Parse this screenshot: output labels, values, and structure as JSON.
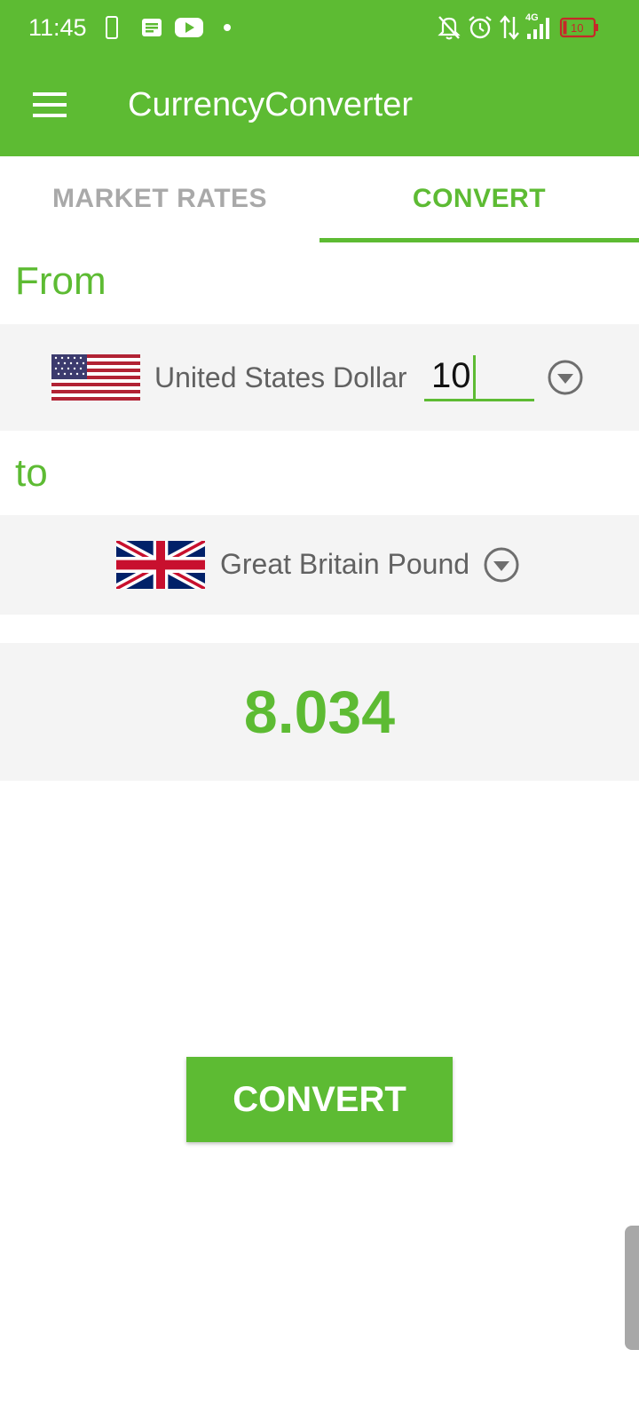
{
  "status_bar": {
    "time": "11:45",
    "network": "4G",
    "battery": "10",
    "icons": [
      "phone-icon",
      "message-icon",
      "youtube-icon",
      "dot-icon",
      "bell-off-icon",
      "alarm-icon",
      "data-arrows-icon",
      "signal-icon",
      "battery-icon"
    ]
  },
  "app_bar": {
    "title": "CurrencyConverter",
    "menu_icon": "hamburger-menu-icon"
  },
  "tabs": [
    {
      "label": "MARKET RATES",
      "selected": false
    },
    {
      "label": "CONVERT",
      "selected": true
    }
  ],
  "converter": {
    "from_label": "From",
    "from_currency": "United States Dollar",
    "from_flag": "us-flag",
    "amount": "10",
    "to_label": "to",
    "to_currency": "Great Britain Pound",
    "to_flag": "uk-flag",
    "result": "8.034"
  },
  "convert_button": "CONVERT",
  "colors": {
    "accent": "#5dbb33",
    "panel": "#f4f4f4",
    "muted_text": "#a9a9a9",
    "currency_text": "#616161"
  }
}
